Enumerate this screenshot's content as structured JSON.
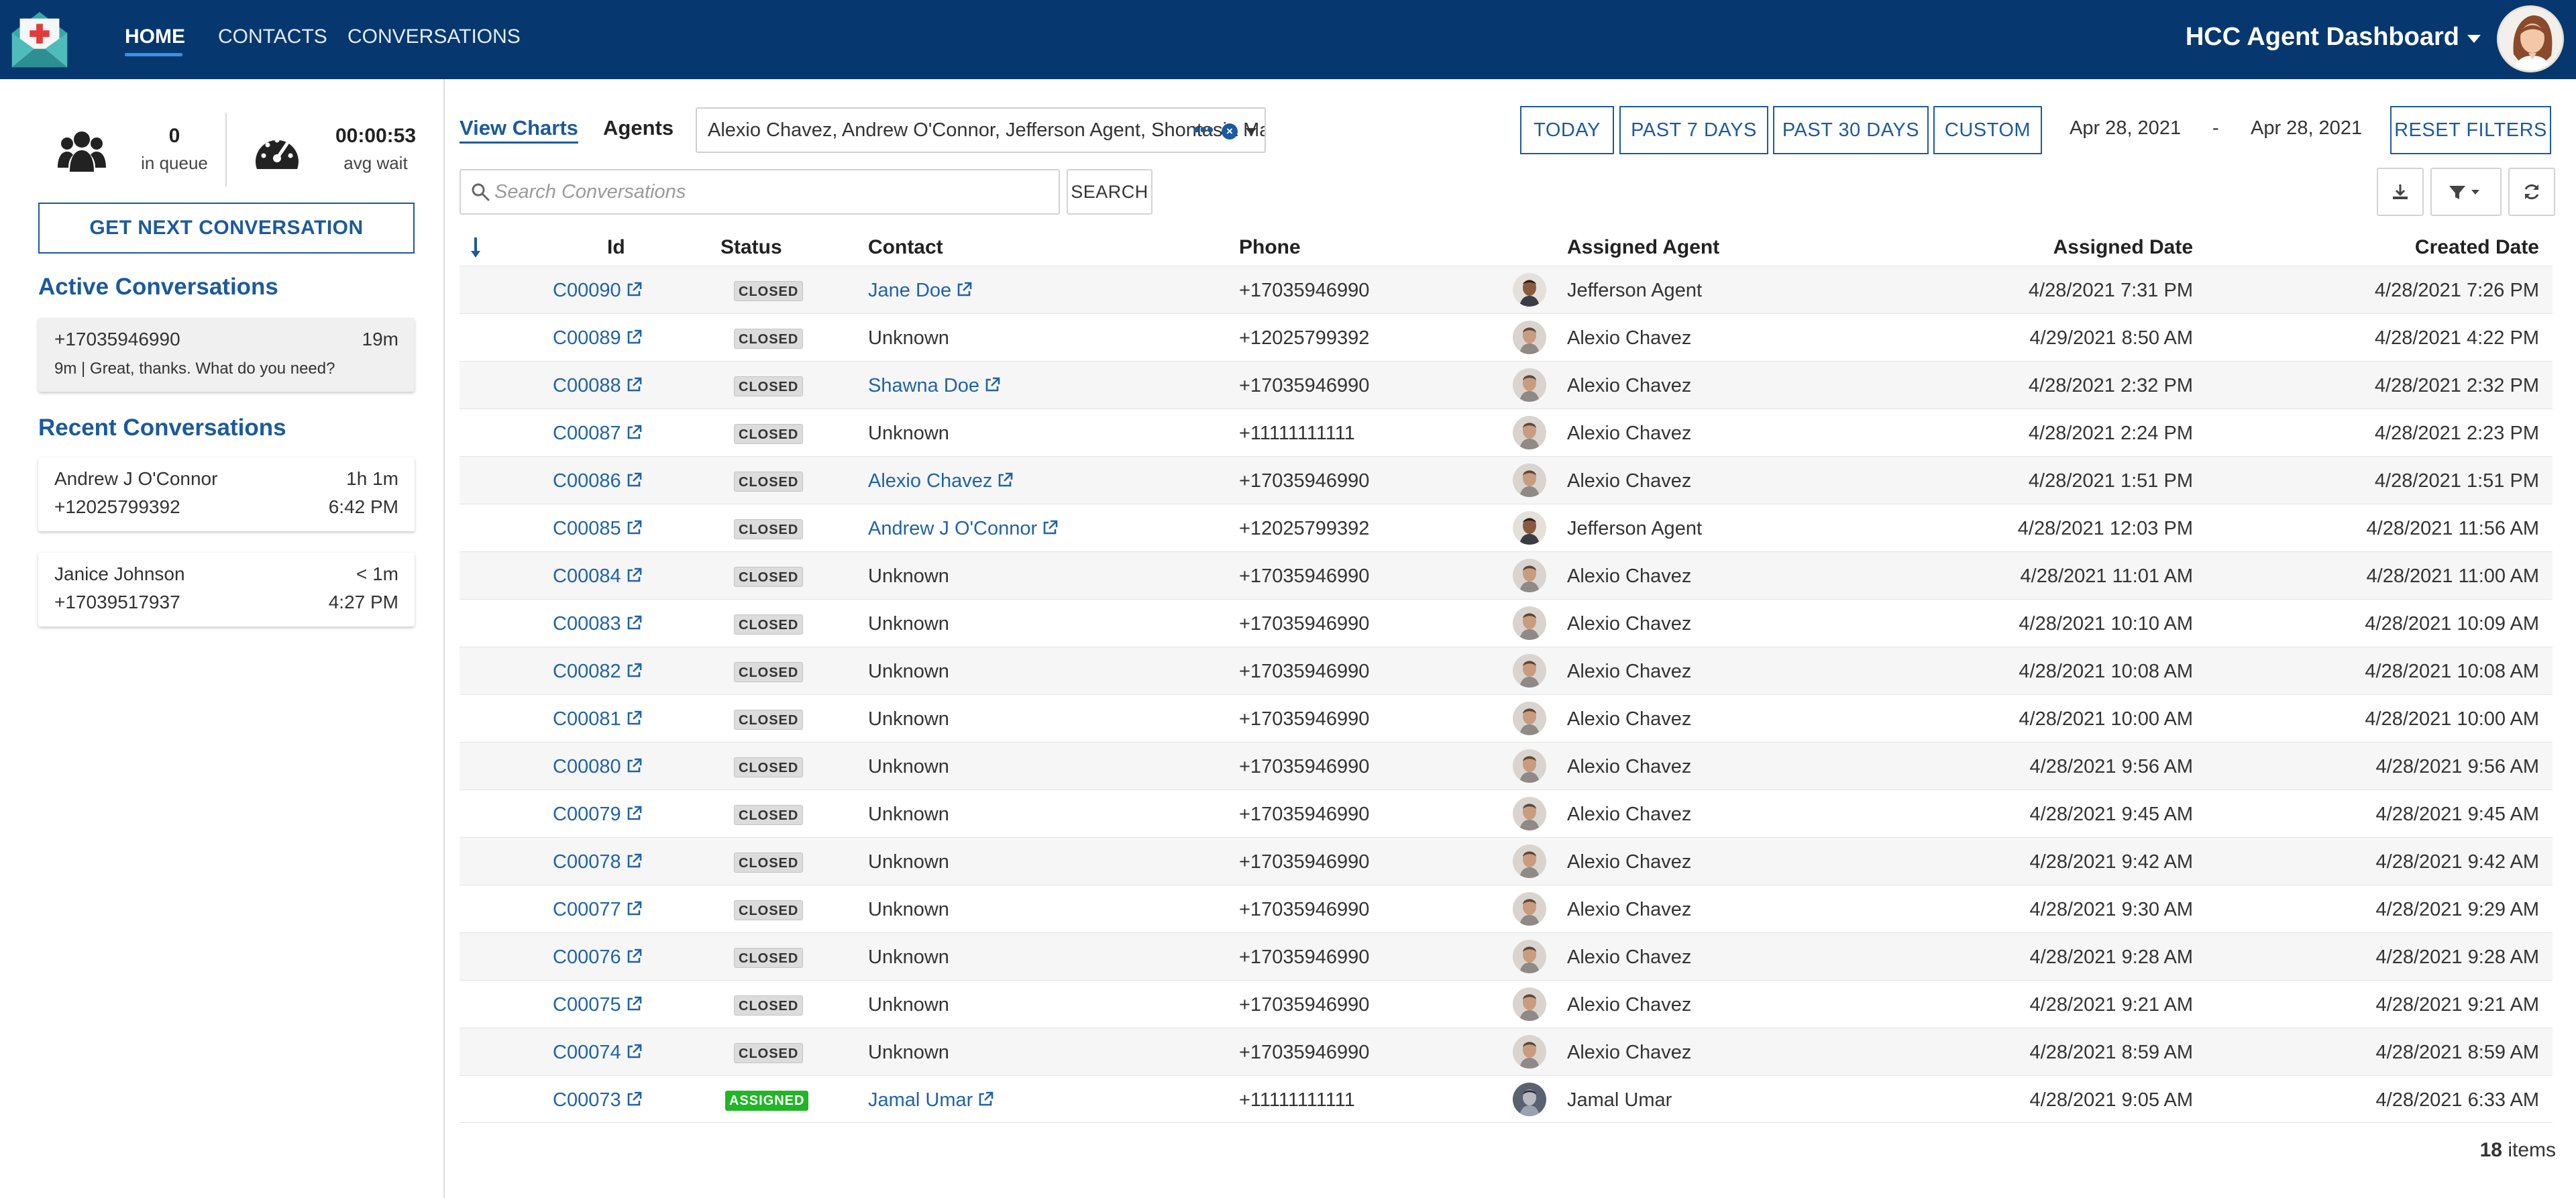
{
  "nav": {
    "items": [
      {
        "label": "HOME",
        "active": true
      },
      {
        "label": "CONTACTS",
        "active": false
      },
      {
        "label": "CONVERSATIONS",
        "active": false
      }
    ],
    "app_title": "HCC Agent Dashboard",
    "brand_color": "#06386f",
    "accent_color": "#1b5a9c"
  },
  "sidebar": {
    "queue": {
      "value": "0",
      "label": "in queue",
      "icon": "users-icon"
    },
    "wait": {
      "value": "00:00:53",
      "label": "avg wait",
      "icon": "speedometer-icon"
    },
    "get_next_label": "GET NEXT CONVERSATION",
    "active_title": "Active Conversations",
    "active": [
      {
        "phone": "+17035946990",
        "age": "19m",
        "preview": "9m | Great, thanks. What do you need?"
      }
    ],
    "recent_title": "Recent Conversations",
    "recent": [
      {
        "name": "Andrew J O'Connor",
        "duration": "1h 1m",
        "phone": "+12025799392",
        "time": "6:42 PM"
      },
      {
        "name": "Janice Johnson",
        "duration": "< 1m",
        "phone": "+17039517937",
        "time": "4:27 PM"
      }
    ]
  },
  "filters": {
    "view_charts": "View Charts",
    "agents_label": "Agents",
    "agents_value": "Alexio Chavez, Andrew O'Connor, Jefferson Agent, Shontasia Manager, Jamal Umar",
    "more": "•••",
    "range_buttons": [
      "TODAY",
      "PAST 7 DAYS",
      "PAST 30 DAYS",
      "CUSTOM"
    ],
    "date_from": "Apr 28, 2021",
    "date_sep": "-",
    "date_to": "Apr 28, 2021",
    "reset_label": "RESET FILTERS",
    "search_placeholder": "Search Conversations",
    "search_label": "SEARCH"
  },
  "table": {
    "columns": [
      "Id",
      "Status",
      "Contact",
      "Phone",
      "Assigned Agent",
      "Assigned Date",
      "Created Date"
    ],
    "status_colors": {
      "CLOSED": "#dcdcdc",
      "ASSIGNED": "#22b527"
    },
    "rows": [
      {
        "id": "C00090",
        "status": "CLOSED",
        "contact": "Jane Doe",
        "contact_link": true,
        "phone": "+17035946990",
        "agent": "Jefferson Agent",
        "avatar": "jefferson",
        "assigned": "4/28/2021 7:31 PM",
        "created": "4/28/2021 7:26 PM"
      },
      {
        "id": "C00089",
        "status": "CLOSED",
        "contact": "Unknown",
        "contact_link": false,
        "phone": "+12025799392",
        "agent": "Alexio Chavez",
        "avatar": "alexio",
        "assigned": "4/29/2021 8:50 AM",
        "created": "4/28/2021 4:22 PM"
      },
      {
        "id": "C00088",
        "status": "CLOSED",
        "contact": "Shawna Doe",
        "contact_link": true,
        "phone": "+17035946990",
        "agent": "Alexio Chavez",
        "avatar": "alexio",
        "assigned": "4/28/2021 2:32 PM",
        "created": "4/28/2021 2:32 PM"
      },
      {
        "id": "C00087",
        "status": "CLOSED",
        "contact": "Unknown",
        "contact_link": false,
        "phone": "+11111111111",
        "agent": "Alexio Chavez",
        "avatar": "alexio",
        "assigned": "4/28/2021 2:24 PM",
        "created": "4/28/2021 2:23 PM"
      },
      {
        "id": "C00086",
        "status": "CLOSED",
        "contact": "Alexio Chavez",
        "contact_link": true,
        "phone": "+17035946990",
        "agent": "Alexio Chavez",
        "avatar": "alexio",
        "assigned": "4/28/2021 1:51 PM",
        "created": "4/28/2021 1:51 PM"
      },
      {
        "id": "C00085",
        "status": "CLOSED",
        "contact": "Andrew J O'Connor",
        "contact_link": true,
        "phone": "+12025799392",
        "agent": "Jefferson Agent",
        "avatar": "jefferson",
        "assigned": "4/28/2021 12:03 PM",
        "created": "4/28/2021 11:56 AM"
      },
      {
        "id": "C00084",
        "status": "CLOSED",
        "contact": "Unknown",
        "contact_link": false,
        "phone": "+17035946990",
        "agent": "Alexio Chavez",
        "avatar": "alexio",
        "assigned": "4/28/2021 11:01 AM",
        "created": "4/28/2021 11:00 AM"
      },
      {
        "id": "C00083",
        "status": "CLOSED",
        "contact": "Unknown",
        "contact_link": false,
        "phone": "+17035946990",
        "agent": "Alexio Chavez",
        "avatar": "alexio",
        "assigned": "4/28/2021 10:10 AM",
        "created": "4/28/2021 10:09 AM"
      },
      {
        "id": "C00082",
        "status": "CLOSED",
        "contact": "Unknown",
        "contact_link": false,
        "phone": "+17035946990",
        "agent": "Alexio Chavez",
        "avatar": "alexio",
        "assigned": "4/28/2021 10:08 AM",
        "created": "4/28/2021 10:08 AM"
      },
      {
        "id": "C00081",
        "status": "CLOSED",
        "contact": "Unknown",
        "contact_link": false,
        "phone": "+17035946990",
        "agent": "Alexio Chavez",
        "avatar": "alexio",
        "assigned": "4/28/2021 10:00 AM",
        "created": "4/28/2021 10:00 AM"
      },
      {
        "id": "C00080",
        "status": "CLOSED",
        "contact": "Unknown",
        "contact_link": false,
        "phone": "+17035946990",
        "agent": "Alexio Chavez",
        "avatar": "alexio",
        "assigned": "4/28/2021 9:56 AM",
        "created": "4/28/2021 9:56 AM"
      },
      {
        "id": "C00079",
        "status": "CLOSED",
        "contact": "Unknown",
        "contact_link": false,
        "phone": "+17035946990",
        "agent": "Alexio Chavez",
        "avatar": "alexio",
        "assigned": "4/28/2021 9:45 AM",
        "created": "4/28/2021 9:45 AM"
      },
      {
        "id": "C00078",
        "status": "CLOSED",
        "contact": "Unknown",
        "contact_link": false,
        "phone": "+17035946990",
        "agent": "Alexio Chavez",
        "avatar": "alexio",
        "assigned": "4/28/2021 9:42 AM",
        "created": "4/28/2021 9:42 AM"
      },
      {
        "id": "C00077",
        "status": "CLOSED",
        "contact": "Unknown",
        "contact_link": false,
        "phone": "+17035946990",
        "agent": "Alexio Chavez",
        "avatar": "alexio",
        "assigned": "4/28/2021 9:30 AM",
        "created": "4/28/2021 9:29 AM"
      },
      {
        "id": "C00076",
        "status": "CLOSED",
        "contact": "Unknown",
        "contact_link": false,
        "phone": "+17035946990",
        "agent": "Alexio Chavez",
        "avatar": "alexio",
        "assigned": "4/28/2021 9:28 AM",
        "created": "4/28/2021 9:28 AM"
      },
      {
        "id": "C00075",
        "status": "CLOSED",
        "contact": "Unknown",
        "contact_link": false,
        "phone": "+17035946990",
        "agent": "Alexio Chavez",
        "avatar": "alexio",
        "assigned": "4/28/2021 9:21 AM",
        "created": "4/28/2021 9:21 AM"
      },
      {
        "id": "C00074",
        "status": "CLOSED",
        "contact": "Unknown",
        "contact_link": false,
        "phone": "+17035946990",
        "agent": "Alexio Chavez",
        "avatar": "alexio",
        "assigned": "4/28/2021 8:59 AM",
        "created": "4/28/2021 8:59 AM"
      },
      {
        "id": "C00073",
        "status": "ASSIGNED",
        "contact": "Jamal Umar",
        "contact_link": true,
        "phone": "+11111111111",
        "agent": "Jamal Umar",
        "avatar": "jamal",
        "assigned": "4/28/2021 9:05 AM",
        "created": "4/28/2021 6:33 AM"
      }
    ],
    "count": "18",
    "count_label": "items"
  }
}
